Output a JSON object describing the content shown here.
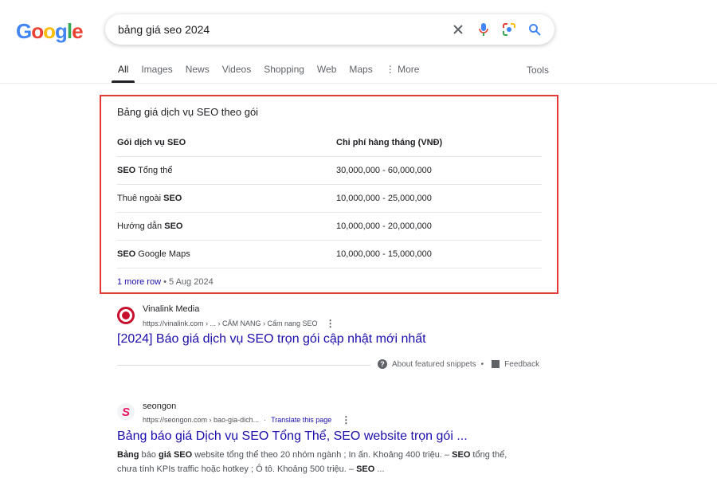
{
  "logo": {
    "text": "Google",
    "letter_colors": [
      "#4285f4",
      "#ea4335",
      "#fbbc05",
      "#4285f4",
      "#34a853",
      "#ea4335"
    ]
  },
  "search": {
    "query": "bảng giá seo 2024",
    "icons": [
      "close-icon",
      "mic-icon",
      "lens-icon",
      "search-icon"
    ]
  },
  "tabs": [
    {
      "label": "All",
      "active": true
    },
    {
      "label": "Images"
    },
    {
      "label": "News"
    },
    {
      "label": "Videos"
    },
    {
      "label": "Shopping"
    },
    {
      "label": "Web"
    },
    {
      "label": "Maps"
    },
    {
      "label": "More",
      "icon": "more-vert-icon"
    }
  ],
  "tools_label": "Tools",
  "featured_snippet": {
    "title": "Bảng giá dịch vụ SEO theo gói",
    "headers": [
      "Gói dịch vụ SEO",
      "Chi phí hàng tháng (VNĐ)"
    ],
    "rows": [
      {
        "service": [
          {
            "t": "SEO",
            "b": true
          },
          {
            "t": " Tổng thể"
          }
        ],
        "price": "30,000,000 - 60,000,000"
      },
      {
        "service": [
          {
            "t": "Thuê ngoài "
          },
          {
            "t": "SEO",
            "b": true
          }
        ],
        "price": "10,000,000 - 25,000,000"
      },
      {
        "service": [
          {
            "t": "Hướng dẫn "
          },
          {
            "t": "SEO",
            "b": true
          }
        ],
        "price": "10,000,000 - 20,000,000"
      },
      {
        "service": [
          {
            "t": "SEO",
            "b": true
          },
          {
            "t": " Google Maps"
          }
        ],
        "price": "10,000,000 - 15,000,000"
      }
    ],
    "more_rows": "1 more row",
    "date": "5 Aug 2024",
    "highlight_color": "#e53935"
  },
  "results": [
    {
      "site": "Vinalink Media",
      "url": "https://vinalink.com › ... › CẨM NANG › Cẩm nang SEO",
      "title": "[2024] Báo giá dịch vụ SEO trọn gói cập nhật mới nhất"
    },
    {
      "site": "seongon",
      "url": "https://seongon.com › bao-gia-dich...",
      "translate": "Translate this page",
      "title": "Bảng báo giá Dịch vụ SEO Tổng Thể, SEO website trọn gói ...",
      "snippet": [
        {
          "t": "Bảng",
          "b": true
        },
        {
          "t": " báo "
        },
        {
          "t": "giá",
          "b": true
        },
        {
          "t": " "
        },
        {
          "t": "SEO",
          "b": true
        },
        {
          "t": " website tổng thể theo 20 nhóm ngành ; In ấn. Khoảng 400 triệu. – "
        },
        {
          "t": "SEO",
          "b": true
        },
        {
          "t": " tổng thể, chưa tính KPIs traffic hoặc hotkey ; Ô tô. Khoảng 500 triệu. – "
        },
        {
          "t": "SEO",
          "b": true
        },
        {
          "t": " ..."
        }
      ]
    }
  ],
  "snippet_footer": {
    "about": "About featured snippets",
    "separator": "•",
    "feedback": "Feedback"
  }
}
